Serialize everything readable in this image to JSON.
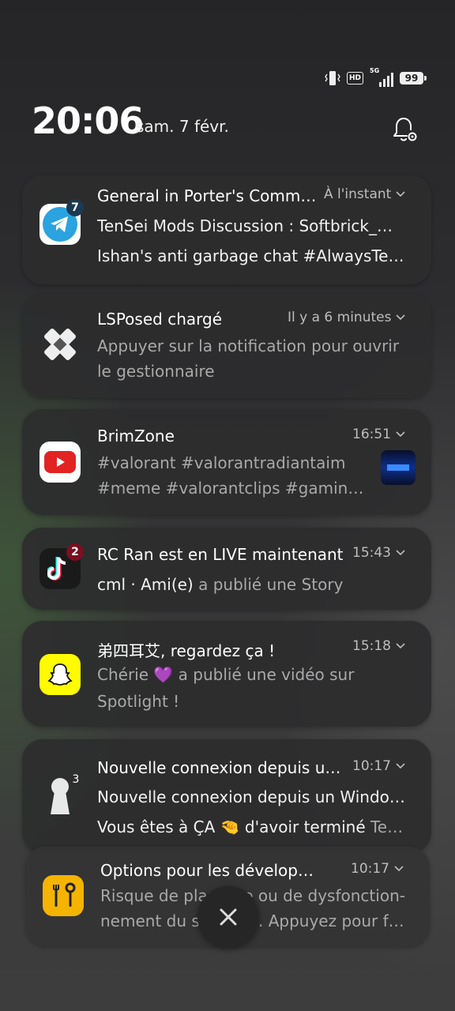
{
  "status_bar": {
    "hd": "HD",
    "network": "5G",
    "battery": "99",
    "icons": [
      "vibrate-icon",
      "hd-icon",
      "signal-5g-icon",
      "battery-icon"
    ]
  },
  "header": {
    "time": "20:06",
    "date": "sam. 7 févr."
  },
  "notifications": [
    {
      "app": "Telegram",
      "icon": "telegram-icon",
      "badge": "7",
      "title": "General in Porter's Comm…",
      "time": "À l'instant",
      "lines": [
        "TenSei Mods Discussion : Softbrick_…",
        "Ishan's anti garbage chat #AlwaysTe…"
      ]
    },
    {
      "app": "LSPosed",
      "icon": "lsposed-icon",
      "title": "LSPosed chargé",
      "time": "Il y a 6 minutes",
      "lines": [
        "Appuyer sur la notification pour ouvrir",
        "le gestionnaire"
      ]
    },
    {
      "app": "YouTube",
      "icon": "youtube-icon",
      "title": "BrimZone",
      "time": "16:51",
      "lines": [
        "#valorant #valorantradiantaim",
        "#meme #valorantclips #gaming …"
      ]
    },
    {
      "app": "TikTok",
      "icon": "tiktok-icon",
      "badge": "2",
      "title": "RC Ran est en LIVE maintenant",
      "time": "15:43",
      "line_bold": "cml · Ami(e)",
      "line_rest": " a publié une Story"
    },
    {
      "app": "Snapchat",
      "icon": "snapchat-icon",
      "title": "弟四耳艾, regardez ça !",
      "time": "15:18",
      "lines": [
        "Chérie 💜 a publié une vidéo sur",
        "Spotlight !"
      ]
    },
    {
      "app": "Security",
      "icon": "keyhole-icon",
      "badge": "3",
      "title": "Nouvelle connexion depuis u…",
      "time": "10:17",
      "lines": [
        "Nouvelle connexion depuis un Windo…"
      ],
      "line3_bold": "Vous êtes à ÇA 🤏 d'avoir terminé",
      "line3_rest": " Te…"
    },
    {
      "app": "Settings",
      "icon": "tools-icon",
      "title": "Options pour les dévelop…",
      "time": "10:17",
      "lines": [
        "Risque de plantage ou de dysfonction-",
        "nement du système. Appuyez pour fe…"
      ]
    }
  ],
  "close_button": {
    "label": "✕",
    "icon": "close-icon"
  }
}
